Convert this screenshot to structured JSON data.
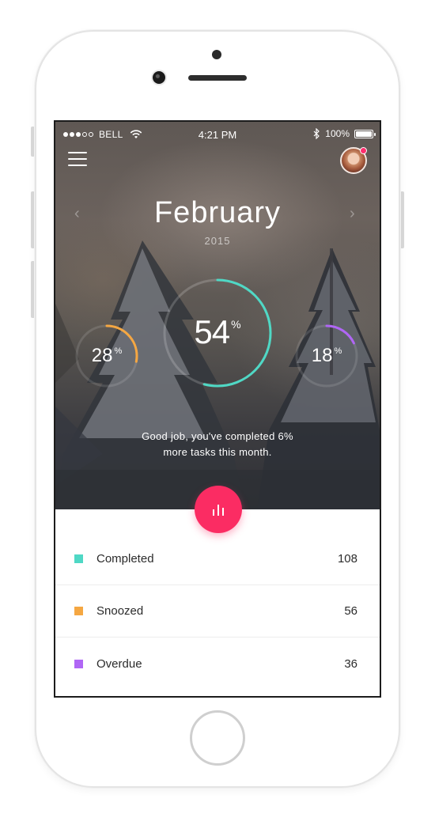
{
  "statusbar": {
    "carrier": "BELL",
    "time": "4:21 PM",
    "battery": "100%",
    "signal_dots_filled": 3,
    "signal_dots_total": 5
  },
  "header": {
    "month": "February",
    "year": "2015",
    "menu_icon": "hamburger-menu-icon",
    "avatar_badge_color": "#ff2d6d"
  },
  "rings": {
    "main": {
      "value": "54",
      "unit": "%",
      "fraction": 0.54,
      "color": "#4fd8c5"
    },
    "left": {
      "value": "28",
      "unit": "%",
      "fraction": 0.28,
      "color": "#f5a742"
    },
    "right": {
      "value": "18",
      "unit": "%",
      "fraction": 0.18,
      "color": "#b066f5"
    }
  },
  "message": {
    "line1": "Good job, you've completed 6%",
    "line2": "more tasks this month."
  },
  "fab": {
    "icon": "bar-chart-icon",
    "color": "#fb2c63"
  },
  "stats": [
    {
      "label": "Completed",
      "value": "108",
      "color": "#4fd8c5"
    },
    {
      "label": "Snoozed",
      "value": "56",
      "color": "#f5a742"
    },
    {
      "label": "Overdue",
      "value": "36",
      "color": "#b066f5"
    }
  ]
}
